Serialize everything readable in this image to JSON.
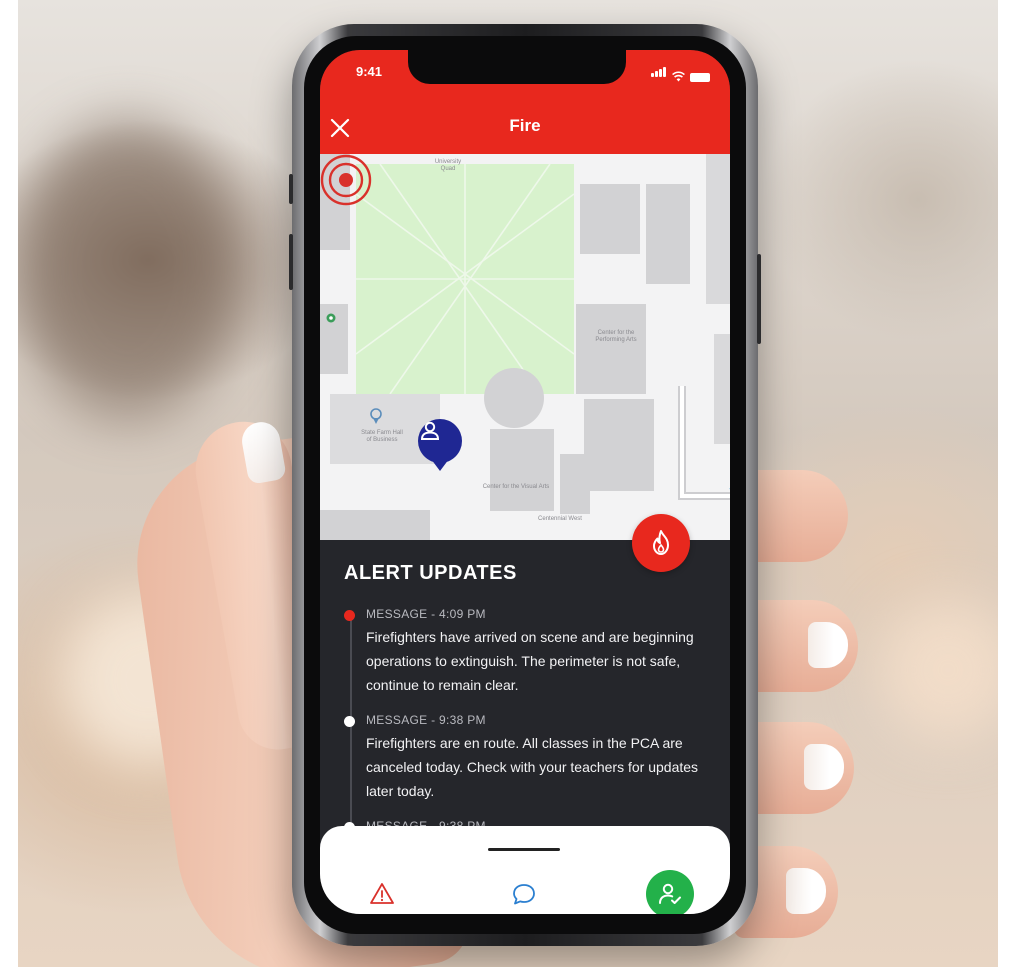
{
  "status_bar": {
    "time": "9:41"
  },
  "header": {
    "title": "Fire"
  },
  "map": {
    "labels": {
      "quad": "University\nQuad",
      "performing_arts": "Center for the\nPerforming Arts",
      "business": "State Farm Hall\nof Business",
      "visual_arts": "Center for the Visual Arts",
      "centennial": "Centennial West"
    }
  },
  "updates": {
    "title": "ALERT UPDATES",
    "items": [
      {
        "meta": "MESSAGE - 4:09 PM",
        "message": "Firefighters have arrived on scene and are beginning operations to extinguish. The perimeter is not safe, continue to remain clear."
      },
      {
        "meta": "MESSAGE - 9:38 PM",
        "message": "Firefighters are en route. All classes in the PCA are canceled today. Check with your teachers for updates later today."
      },
      {
        "meta": "MESSAGE - 9:38 PM",
        "message": ""
      }
    ]
  },
  "colors": {
    "accent": "#e8281e",
    "panel": "#25262b",
    "user_pin": "#1f2793",
    "safe": "#23b14a",
    "map_green": "#d8f2cd"
  },
  "icons": {
    "close": "close-icon",
    "fire": "fire-icon",
    "user_pin": "user-icon",
    "alert": "warning-icon",
    "chat": "chat-icon",
    "checkin": "user-check-icon"
  }
}
